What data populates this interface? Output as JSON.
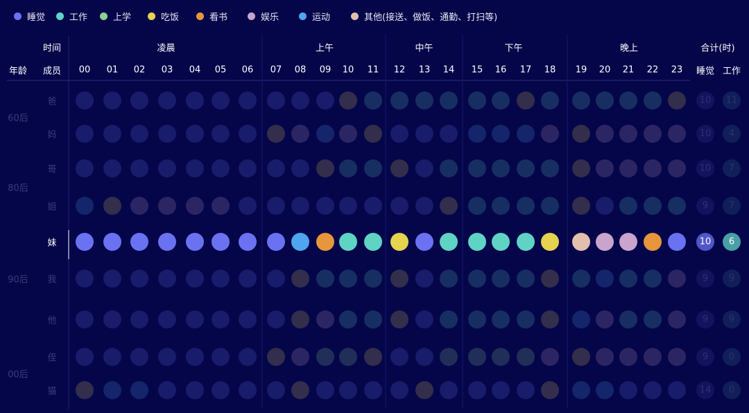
{
  "legend": [
    {
      "key": "sleep",
      "label": "睡觉",
      "color": "#6a72f2"
    },
    {
      "key": "work",
      "label": "工作",
      "color": "#5fd3c4"
    },
    {
      "key": "school",
      "label": "上学",
      "color": "#8fd08f"
    },
    {
      "key": "eat",
      "label": "吃饭",
      "color": "#e6d34e"
    },
    {
      "key": "read",
      "label": "看书",
      "color": "#e8963b"
    },
    {
      "key": "fun",
      "label": "娱乐",
      "color": "#c9a4cc"
    },
    {
      "key": "sport",
      "label": "运动",
      "color": "#4fa6ee"
    },
    {
      "key": "other",
      "label": "其他(接送、做饭、通勤、打扫等)",
      "color": "#e3bfae"
    }
  ],
  "header": {
    "time_label": "时间",
    "member_label": "成员",
    "age_label": "年龄",
    "total_label": "合计(时)",
    "total_cols": [
      "睡觉",
      "工作"
    ]
  },
  "chart_data": {
    "type": "dot-matrix",
    "periods": [
      {
        "label": "凌晨",
        "hours": [
          "00",
          "01",
          "02",
          "03",
          "04",
          "05",
          "06"
        ]
      },
      {
        "label": "上午",
        "hours": [
          "07",
          "08",
          "09",
          "10",
          "11"
        ]
      },
      {
        "label": "中午",
        "hours": [
          "12",
          "13",
          "14"
        ]
      },
      {
        "label": "下午",
        "hours": [
          "15",
          "16",
          "17",
          "18"
        ]
      },
      {
        "label": "晚上",
        "hours": [
          "19",
          "20",
          "21",
          "22",
          "23"
        ]
      }
    ],
    "age_groups": [
      {
        "label": "60后",
        "members": [
          "爸",
          "妈"
        ]
      },
      {
        "label": "80后",
        "members": [
          "哥",
          "姐"
        ]
      },
      {
        "label": "90后",
        "members": [
          "妹",
          "我",
          "他"
        ]
      },
      {
        "label": "00后",
        "members": [
          "侄",
          "猫"
        ]
      }
    ],
    "highlighted_member": "妹",
    "rows": [
      {
        "member": "爸",
        "hours": [
          "sleep",
          "sleep",
          "sleep",
          "sleep",
          "sleep",
          "sleep",
          "sleep",
          "sleep",
          "sleep",
          "sleep",
          "eat",
          "work",
          "work",
          "work",
          "work",
          "work",
          "work",
          "eat",
          "work",
          "work",
          "work",
          "work",
          "work",
          "eat"
        ],
        "totals": {
          "sleep": 10,
          "work": 11
        }
      },
      {
        "member": "妈",
        "hours": [
          "sleep",
          "sleep",
          "sleep",
          "sleep",
          "sleep",
          "sleep",
          "sleep",
          "eat",
          "fun",
          "sport",
          "fun",
          "eat",
          "sleep",
          "sleep",
          "sleep",
          "sport",
          "sport",
          "sport",
          "fun",
          "eat",
          "fun",
          "fun",
          "fun",
          "fun"
        ],
        "totals": {
          "sleep": 10,
          "work": 4
        }
      },
      {
        "member": "哥",
        "hours": [
          "sleep",
          "sleep",
          "sleep",
          "sleep",
          "sleep",
          "sleep",
          "sleep",
          "sleep",
          "sleep",
          "eat",
          "work",
          "work",
          "eat",
          "sleep",
          "work",
          "work",
          "work",
          "work",
          "work",
          "eat",
          "fun",
          "fun",
          "fun",
          "fun"
        ],
        "totals": {
          "sleep": 10,
          "work": 7
        }
      },
      {
        "member": "姐",
        "hours": [
          "sport",
          "eat",
          "fun",
          "fun",
          "fun",
          "fun",
          "sleep",
          "sleep",
          "sleep",
          "sleep",
          "sleep",
          "sleep",
          "sleep",
          "sleep",
          "eat",
          "work",
          "work",
          "work",
          "work",
          "eat",
          "sleep",
          "work",
          "work",
          "work"
        ],
        "totals": {
          "sleep": 9,
          "work": 7
        }
      },
      {
        "member": "妹",
        "hours": [
          "sleep",
          "sleep",
          "sleep",
          "sleep",
          "sleep",
          "sleep",
          "sleep",
          "sleep",
          "sport",
          "read",
          "work",
          "work",
          "eat",
          "sleep",
          "work",
          "work",
          "work",
          "work",
          "eat",
          "other",
          "fun",
          "fun",
          "read",
          "sleep"
        ],
        "totals": {
          "sleep": 10,
          "work": 6
        }
      },
      {
        "member": "我",
        "hours": [
          "sleep",
          "sleep",
          "sleep",
          "sleep",
          "sleep",
          "sleep",
          "sleep",
          "sleep",
          "eat",
          "work",
          "work",
          "work",
          "eat",
          "sleep",
          "work",
          "work",
          "work",
          "work",
          "eat",
          "work",
          "sport",
          "work",
          "work",
          "fun"
        ],
        "totals": {
          "sleep": 9,
          "work": 9
        }
      },
      {
        "member": "他",
        "hours": [
          "sleep",
          "sleep",
          "sleep",
          "sleep",
          "sleep",
          "sleep",
          "sleep",
          "sleep",
          "eat",
          "fun",
          "work",
          "work",
          "eat",
          "sleep",
          "work",
          "work",
          "work",
          "work",
          "eat",
          "sport",
          "fun",
          "work",
          "work",
          "fun"
        ],
        "totals": {
          "sleep": 9,
          "work": 9
        }
      },
      {
        "member": "侄",
        "hours": [
          "sleep",
          "sleep",
          "sleep",
          "sleep",
          "sleep",
          "sleep",
          "sleep",
          "eat",
          "fun",
          "school",
          "school",
          "eat",
          "sleep",
          "sleep",
          "school",
          "school",
          "school",
          "school",
          "fun",
          "eat",
          "fun",
          "fun",
          "fun",
          "fun"
        ],
        "totals": {
          "sleep": 9,
          "work": 0
        }
      },
      {
        "member": "猫",
        "hours": [
          "eat",
          "sport",
          "sport",
          "sleep",
          "sleep",
          "sleep",
          "sleep",
          "sleep",
          "eat",
          "sleep",
          "sleep",
          "sleep",
          "sleep",
          "eat",
          "sleep",
          "sleep",
          "sleep",
          "sleep",
          "eat",
          "sport",
          "sport",
          "sleep",
          "sleep",
          "sleep"
        ],
        "totals": {
          "sleep": 14,
          "work": 0
        }
      }
    ]
  }
}
